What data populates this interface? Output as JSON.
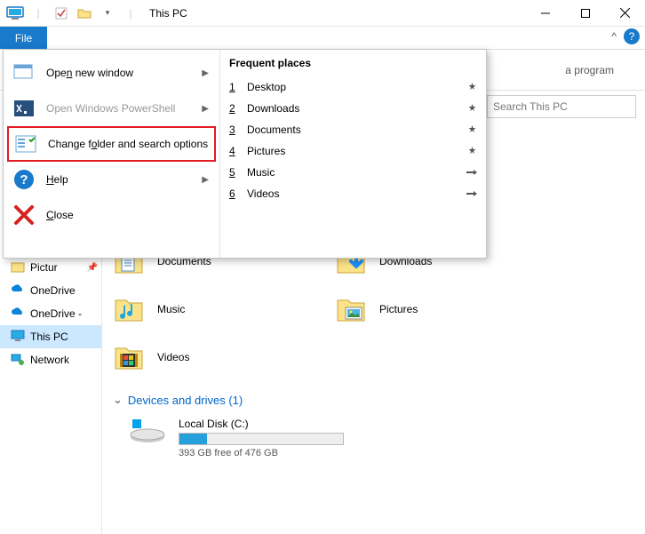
{
  "titlebar": {
    "title": "This PC"
  },
  "ribbon": {
    "file_tab": "File"
  },
  "info_strip": {
    "text": "a program"
  },
  "search": {
    "placeholder": "Search This PC"
  },
  "file_menu": {
    "items": [
      {
        "label": "Open new window",
        "underline": "n",
        "has_sub": true,
        "disabled": false
      },
      {
        "label": "Open Windows PowerShell",
        "underline": "",
        "has_sub": true,
        "disabled": true
      },
      {
        "label": "Change folder and search options",
        "underline": "o",
        "has_sub": false,
        "disabled": false,
        "highlight": true
      },
      {
        "label": "Help",
        "underline": "H",
        "has_sub": true,
        "disabled": false
      },
      {
        "label": "Close",
        "underline": "C",
        "has_sub": false,
        "disabled": false
      }
    ],
    "frequent_header": "Frequent places",
    "frequent": [
      {
        "n": "1",
        "label": "Desktop",
        "pinned": true
      },
      {
        "n": "2",
        "label": "Downloads",
        "pinned": true
      },
      {
        "n": "3",
        "label": "Documents",
        "pinned": true
      },
      {
        "n": "4",
        "label": "Pictures",
        "pinned": true
      },
      {
        "n": "5",
        "label": "Music",
        "pinned": false
      },
      {
        "n": "6",
        "label": "Videos",
        "pinned": false
      }
    ]
  },
  "sidebar": {
    "items": [
      {
        "label": "Pictur",
        "icon": "pictures",
        "pin": true
      },
      {
        "label": "OneDrive",
        "icon": "onedrive"
      },
      {
        "label": "OneDrive -",
        "icon": "onedrive"
      },
      {
        "label": "This PC",
        "icon": "thispc",
        "selected": true
      },
      {
        "label": "Network",
        "icon": "network"
      }
    ]
  },
  "folders": [
    {
      "label": "Documents",
      "icon": "documents"
    },
    {
      "label": "Downloads",
      "icon": "downloads"
    },
    {
      "label": "Music",
      "icon": "music"
    },
    {
      "label": "Pictures",
      "icon": "pictures"
    },
    {
      "label": "Videos",
      "icon": "videos"
    }
  ],
  "section": {
    "header": "Devices and drives (1)"
  },
  "drive": {
    "name": "Local Disk (C:)",
    "free_text": "393 GB free of 476 GB",
    "used_pct": 17
  }
}
